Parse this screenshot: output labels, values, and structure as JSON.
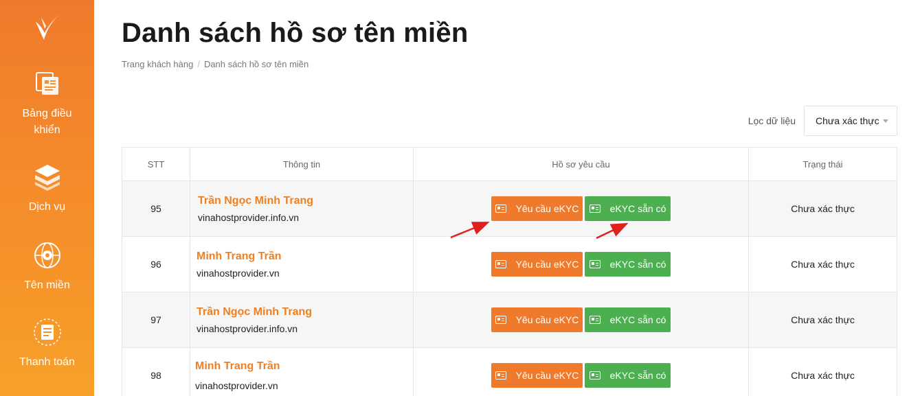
{
  "sidebar": {
    "items": [
      {
        "label": "Bảng điều khiển",
        "icon": "dashboard-icon"
      },
      {
        "label": "Dịch vụ",
        "icon": "services-layers-icon"
      },
      {
        "label": "Tên miền",
        "icon": "globe-icon"
      },
      {
        "label": "Thanh toán",
        "icon": "invoice-icon"
      }
    ],
    "logo": "brand-logo-icon"
  },
  "header": {
    "title": "Danh sách hồ sơ tên miền",
    "breadcrumb": [
      "Trang khách hàng",
      "Danh sách hồ sơ tên miền"
    ]
  },
  "filter": {
    "label": "Lọc dữ liệu",
    "selected": "Chưa xác thực"
  },
  "table": {
    "columns": [
      "STT",
      "Thông tin",
      "Hồ sơ yêu cầu",
      "Trạng thái"
    ],
    "rows": [
      {
        "stt": "95",
        "name": "Trần Ngọc Minh Trang",
        "domain": "vinahostprovider.info.vn",
        "btn_request": "Yêu cầu eKYC",
        "btn_available": "eKYC sẵn có",
        "status": "Chưa xác thực"
      },
      {
        "stt": "96",
        "name": "Minh Trang Trần",
        "domain": "vinahostprovider.vn",
        "btn_request": "Yêu cầu eKYC",
        "btn_available": "eKYC sẵn có",
        "status": "Chưa xác thực"
      },
      {
        "stt": "97",
        "name": "Trần Ngọc Minh Trang",
        "domain": "vinahostprovider.info.vn",
        "btn_request": "Yêu cầu eKYC",
        "btn_available": "eKYC sẵn có",
        "status": "Chưa xác thực"
      },
      {
        "stt": "98",
        "name": "Minh Trang Trần",
        "domain": "vinahostprovider.vn",
        "btn_request": "Yêu cầu eKYC",
        "btn_available": "eKYC sẵn có",
        "status": "Chưa xác thực"
      }
    ]
  },
  "colors": {
    "accent_orange": "#f07a2c",
    "accent_green": "#4caf50",
    "annotation_red": "#e0201f"
  }
}
